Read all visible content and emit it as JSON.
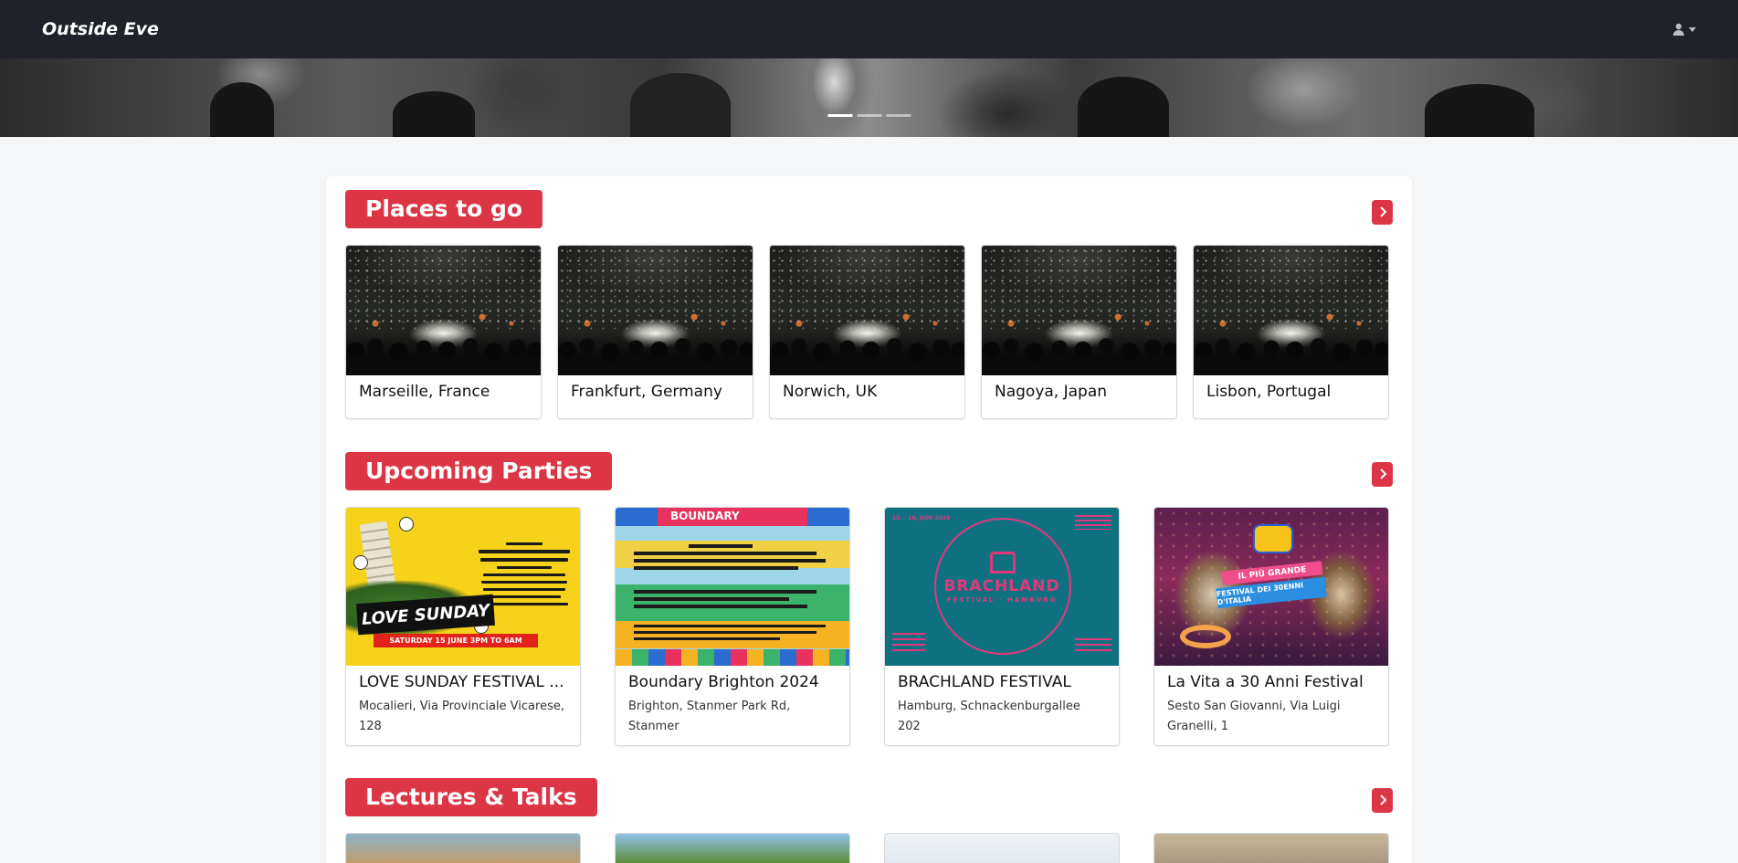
{
  "navbar": {
    "brand": "Outside Eve",
    "user_icon": "user-icon",
    "caret_icon": "caret-down-icon"
  },
  "hero": {
    "indicators": 3,
    "active_indicator": 1
  },
  "sections": {
    "places": {
      "title": "Places to go",
      "items": [
        {
          "name": "Marseille, France"
        },
        {
          "name": "Frankfurt, Germany"
        },
        {
          "name": "Norwich, UK"
        },
        {
          "name": "Nagoya, Japan"
        },
        {
          "name": "Lisbon, Portugal"
        }
      ]
    },
    "parties": {
      "title": "Upcoming Parties",
      "items": [
        {
          "title": "LOVE SUNDAY FESTIVAL ...",
          "address": "Mocalieri, Via Provinciale Vicarese, 128"
        },
        {
          "title": "Boundary Brighton 2024",
          "address": "Brighton, Stanmer Park Rd, Stanmer"
        },
        {
          "title": "BRACHLAND FESTIVAL",
          "address": "Hamburg, Schnackenburgallee 202"
        },
        {
          "title": "La Vita a 30 Anni Festival",
          "address": "Sesto San Giovanni, Via Luigi Granelli, 1"
        }
      ]
    },
    "lectures": {
      "title": "Lectures & Talks"
    }
  },
  "posters": {
    "love_sunday": {
      "logo": "LOVE SUNDAY",
      "date": "SATURDAY 15 JUNE 3PM TO 6AM"
    },
    "boundary": {
      "header": "BOUNDARY"
    },
    "brachland": {
      "wordmark": "BRACHLAND",
      "subtitle": "FESTIVAL · HAMBURG",
      "date": "15. - 16. JUNI 2024"
    },
    "la_vita": {
      "ribbon_1": "IL PIÙ GRANDE",
      "ribbon_2": "FESTIVAL DEI 30ENNI D'ITALIA"
    }
  },
  "colors": {
    "navbar_bg": "#1f2329",
    "accent": "#dc3545",
    "page_bg": "#f5f6f8"
  }
}
